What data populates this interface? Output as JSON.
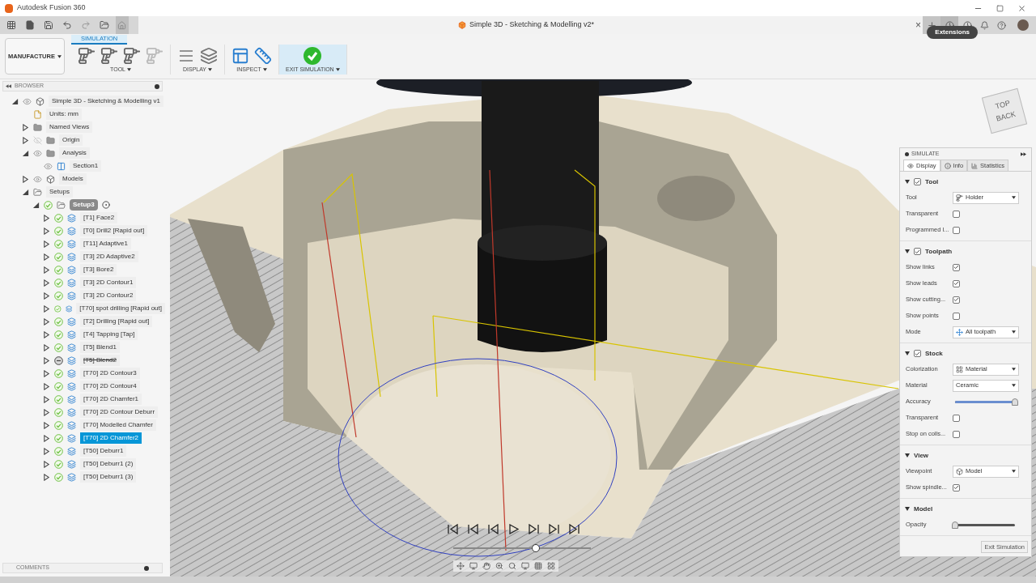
{
  "window": {
    "title": "Autodesk Fusion 360"
  },
  "document_tab": {
    "title": "Simple 3D - Sketching & Modelling v2*",
    "close": "×"
  },
  "tooltip": {
    "text": "Extensions"
  },
  "ribbon": {
    "workspace": "MANUFACTURE",
    "tabs": [
      {
        "label": "SIMULATION",
        "selected": true
      }
    ],
    "groups": [
      {
        "label": "TOOL",
        "kind": "tool"
      },
      {
        "label": "DISPLAY",
        "kind": "display"
      },
      {
        "label": "INSPECT",
        "kind": "inspect"
      },
      {
        "label": "EXIT SIMULATION",
        "kind": "exit"
      }
    ]
  },
  "browser": {
    "title": "BROWSER",
    "tree": [
      {
        "label": "Simple 3D - Sketching & Modelling v1",
        "kind": "component",
        "visible": true,
        "expanded": true,
        "children": [
          {
            "label": "Units: mm",
            "kind": "units"
          },
          {
            "label": "Named Views",
            "kind": "folder",
            "expanded": false
          },
          {
            "label": "Origin",
            "kind": "folder",
            "visible": false,
            "expanded": false
          },
          {
            "label": "Analysis",
            "kind": "folder",
            "visible": true,
            "expanded": true,
            "children": [
              {
                "label": "Section1",
                "kind": "section",
                "visible": true
              }
            ]
          },
          {
            "label": "Models",
            "kind": "component",
            "visible": true,
            "expanded": false
          },
          {
            "label": "Setups",
            "kind": "openfolder",
            "expanded": true,
            "children": [
              {
                "label": "Setup3",
                "kind": "setup",
                "suppressed": false,
                "expanded": true,
                "active": true,
                "children": [
                  {
                    "label": "[T1] Face2",
                    "kind": "operation",
                    "suppressed": false,
                    "expanded": false,
                    "selected": false
                  },
                  {
                    "label": "[T0] Drill2 [Rapid out]",
                    "kind": "operation",
                    "suppressed": false,
                    "expanded": false,
                    "selected": false
                  },
                  {
                    "label": "[T11] Adaptive1",
                    "kind": "operation",
                    "suppressed": false,
                    "expanded": false,
                    "selected": false
                  },
                  {
                    "label": "[T3] 2D Adaptive2",
                    "kind": "operation",
                    "suppressed": false,
                    "expanded": false,
                    "selected": false
                  },
                  {
                    "label": "[T3] Bore2",
                    "kind": "operation",
                    "suppressed": false,
                    "expanded": false,
                    "selected": false
                  },
                  {
                    "label": "[T3] 2D Contour1",
                    "kind": "operation",
                    "suppressed": false,
                    "expanded": false,
                    "selected": false
                  },
                  {
                    "label": "[T3] 2D Contour2",
                    "kind": "operation",
                    "suppressed": false,
                    "expanded": false,
                    "selected": false
                  },
                  {
                    "label": "[T70] spot drilling [Rapid out]",
                    "kind": "operation",
                    "suppressed": false,
                    "expanded": false,
                    "selected": false
                  },
                  {
                    "label": "[T2] Drilling [Rapid out]",
                    "kind": "operation",
                    "suppressed": false,
                    "expanded": false,
                    "selected": false
                  },
                  {
                    "label": "[T4] Tapping [Tap]",
                    "kind": "operation",
                    "suppressed": false,
                    "expanded": false,
                    "selected": false
                  },
                  {
                    "label": "[T5] Blend1",
                    "kind": "operation",
                    "suppressed": false,
                    "expanded": false,
                    "selected": false
                  },
                  {
                    "label": "[T5] Blend2",
                    "kind": "operation",
                    "suppressed": true,
                    "expanded": false,
                    "selected": false
                  },
                  {
                    "label": "[T70] 2D Contour3",
                    "kind": "operation",
                    "suppressed": false,
                    "expanded": false,
                    "selected": false
                  },
                  {
                    "label": "[T70] 2D Contour4",
                    "kind": "operation",
                    "suppressed": false,
                    "expanded": false,
                    "selected": false
                  },
                  {
                    "label": "[T70] 2D Chamfer1",
                    "kind": "operation",
                    "suppressed": false,
                    "expanded": false,
                    "selected": false
                  },
                  {
                    "label": "[T70] 2D Contour Deburr",
                    "kind": "operation",
                    "suppressed": false,
                    "expanded": false,
                    "selected": false
                  },
                  {
                    "label": "[T70] Modelled Chamfer",
                    "kind": "operation",
                    "suppressed": false,
                    "expanded": false,
                    "selected": false
                  },
                  {
                    "label": "[T70] 2D Chamfer2",
                    "kind": "operation",
                    "suppressed": false,
                    "expanded": false,
                    "selected": true
                  },
                  {
                    "label": "[T50] Deburr1",
                    "kind": "operation",
                    "suppressed": false,
                    "expanded": false,
                    "selected": false
                  },
                  {
                    "label": "[T50] Deburr1 (2)",
                    "kind": "operation",
                    "suppressed": false,
                    "expanded": false,
                    "selected": false
                  },
                  {
                    "label": "[T50] Deburr1 (3)",
                    "kind": "operation",
                    "suppressed": false,
                    "expanded": false,
                    "selected": false
                  }
                ]
              }
            ]
          }
        ]
      }
    ]
  },
  "comments": {
    "title": "COMMENTS"
  },
  "viewcube": {
    "faces": [
      "TOP",
      "BACK"
    ]
  },
  "simulate": {
    "title": "SIMULATE",
    "tabs": [
      {
        "label": "Display",
        "selected": true
      },
      {
        "label": "Info",
        "selected": false
      },
      {
        "label": "Statistics",
        "selected": false
      }
    ],
    "sections": [
      {
        "title": "Tool",
        "expanded": true,
        "checked": true,
        "rows": [
          {
            "kind": "dropdown",
            "label": "Tool",
            "value": "Holder"
          },
          {
            "kind": "checkbox",
            "label": "Transparent",
            "checked": false
          },
          {
            "kind": "checkbox",
            "label": "Programmed l...",
            "checked": false
          }
        ]
      },
      {
        "title": "Toolpath",
        "expanded": true,
        "checked": true,
        "rows": [
          {
            "kind": "checkbox",
            "label": "Show links",
            "checked": true
          },
          {
            "kind": "checkbox",
            "label": "Show leads",
            "checked": true
          },
          {
            "kind": "checkbox",
            "label": "Show cutting...",
            "checked": true
          },
          {
            "kind": "checkbox",
            "label": "Show points",
            "checked": false
          },
          {
            "kind": "dropdown",
            "label": "Mode",
            "value": "All toolpath"
          }
        ]
      },
      {
        "title": "Stock",
        "expanded": true,
        "checked": true,
        "rows": [
          {
            "kind": "dropdown",
            "label": "Colorization",
            "value": "Material"
          },
          {
            "kind": "dropdown",
            "label": "Material",
            "value": "Ceramic"
          },
          {
            "kind": "slider",
            "label": "Accuracy",
            "level": 1
          },
          {
            "kind": "checkbox",
            "label": "Transparent",
            "checked": false
          },
          {
            "kind": "checkbox",
            "label": "Stop on colls...",
            "checked": false
          }
        ]
      },
      {
        "title": "View",
        "expanded": true,
        "rows": [
          {
            "kind": "dropdown",
            "label": "Viewpoint",
            "value": "Model"
          },
          {
            "kind": "checkbox",
            "label": "Show spindle...",
            "checked": true
          }
        ]
      },
      {
        "title": "Model",
        "expanded": true,
        "rows": [
          {
            "kind": "slider",
            "label": "Opacity",
            "level": 0
          }
        ]
      }
    ],
    "button": "Exit Simulation"
  },
  "playback": {
    "level": 0.6
  }
}
